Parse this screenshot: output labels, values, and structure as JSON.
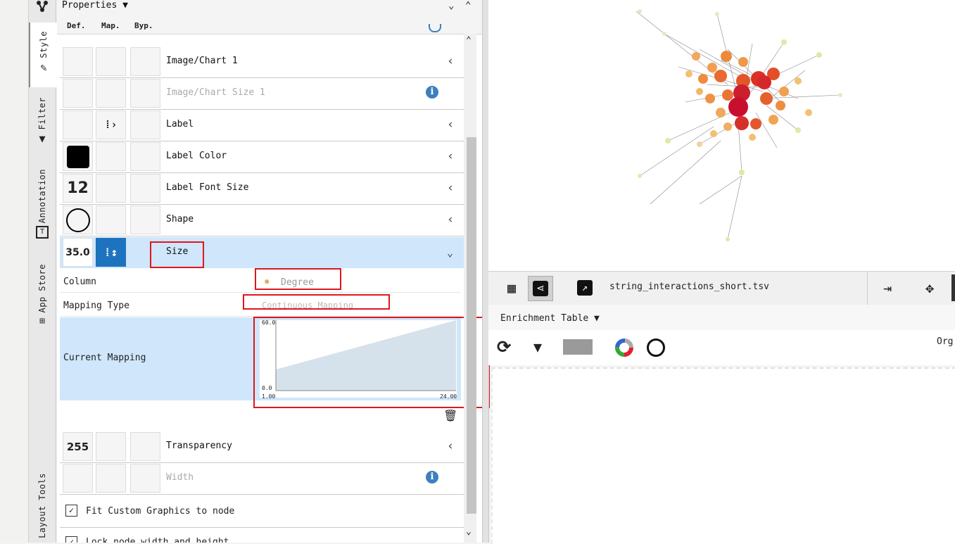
{
  "sidebar_tabs": [
    {
      "label": "Style",
      "icon": "brush-icon",
      "active": true
    },
    {
      "label": "Filter",
      "icon": "filter-icon",
      "active": false
    },
    {
      "label": "Annotation",
      "icon": "annotation-icon",
      "active": false
    },
    {
      "label": "App Store",
      "icon": "app-store-icon",
      "active": false
    },
    {
      "label": "Layout Tools",
      "icon": "",
      "active": false
    }
  ],
  "properties": {
    "title": "Properties ▼",
    "columns": {
      "def": "Def.",
      "map": "Map.",
      "byp": "Byp."
    },
    "rows": [
      {
        "label": "Image/Chart 1",
        "def": "",
        "map": "",
        "enabled": true
      },
      {
        "label": "Image/Chart Size 1",
        "def": "",
        "map": "",
        "enabled": false
      },
      {
        "label": "Label",
        "def": "",
        "map": "passthrough-mapping-icon",
        "enabled": true
      },
      {
        "label": "Label Color",
        "def": "#000000",
        "map": "",
        "enabled": true
      },
      {
        "label": "Label Font Size",
        "def": "12",
        "map": "",
        "enabled": true
      },
      {
        "label": "Shape",
        "def": "ellipse-icon",
        "map": "",
        "enabled": true
      },
      {
        "label": "Size",
        "def": "35.0",
        "map": "continuous-mapping-icon",
        "enabled": true,
        "expanded": true
      },
      {
        "label": "Transparency",
        "def": "255",
        "map": "",
        "enabled": true
      },
      {
        "label": "Width",
        "def": "",
        "map": "",
        "enabled": false
      }
    ],
    "size_mapping": {
      "column_label": "Column",
      "column_value": "Degree",
      "mapping_type_label": "Mapping Type",
      "mapping_type_value": "Continuous Mapping",
      "current_mapping_label": "Current Mapping",
      "y_max": "60.0",
      "y_min": "0.0",
      "x_min": "1.00",
      "x_max": "24.00"
    },
    "checkboxes": [
      {
        "label": "Fit Custom Graphics to node",
        "checked": true
      },
      {
        "label": "Lock node width and height",
        "checked": true
      }
    ]
  },
  "network": {
    "title": "string_interactions_short.tsv"
  },
  "enrichment": {
    "title": "Enrichment Table ▼",
    "right_label": "Org"
  },
  "colors": {
    "accent": "#1e73be",
    "highlight_box": "#e0161c",
    "selected_row": "#cfe6fb",
    "info_blue": "#3d7fbf",
    "node_red": "#c8102e",
    "node_orange": "#f29a4a"
  }
}
